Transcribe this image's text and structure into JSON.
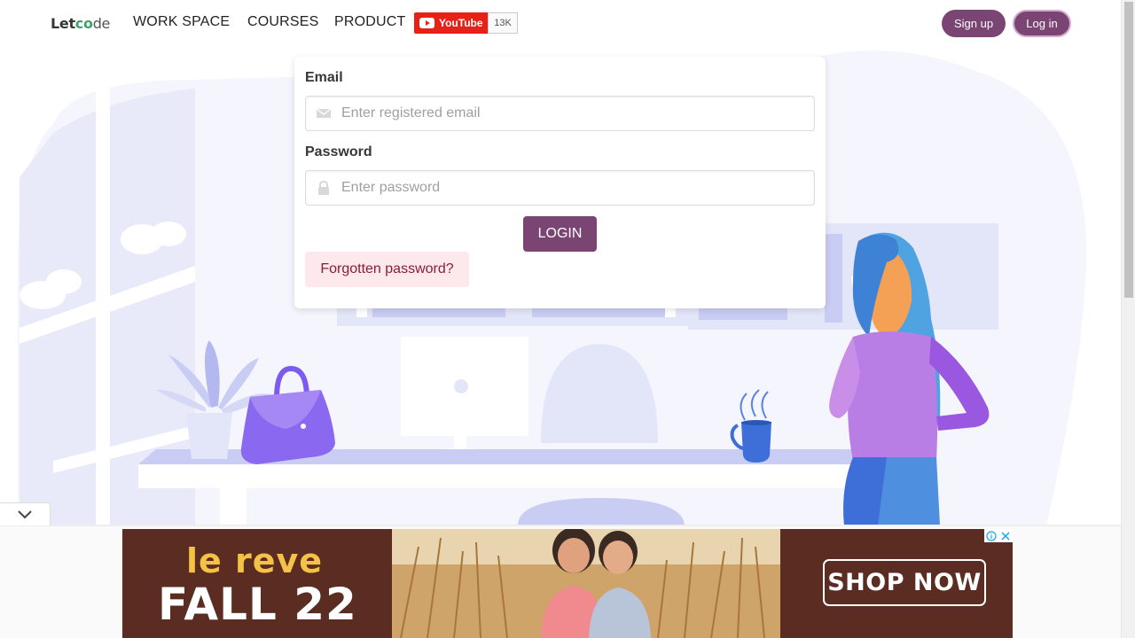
{
  "nav": {
    "logo_let": "Let",
    "logo_co": "co",
    "logo_de": "de",
    "links": [
      "WORK SPACE",
      "COURSES",
      "PRODUCT"
    ],
    "youtube_label": "YouTube",
    "youtube_count": "13K",
    "signup_label": "Sign up",
    "login_label": "Log in"
  },
  "form": {
    "email_label": "Email",
    "email_placeholder": "Enter registered email",
    "email_value": "",
    "password_label": "Password",
    "password_placeholder": "Enter password",
    "password_value": "",
    "submit_label": "LOGIN",
    "forgot_label": "Forgotten password?"
  },
  "ad": {
    "brand": "le reve",
    "season": "FALL 22",
    "cta": "SHOP NOW"
  },
  "colors": {
    "primary": "#7a4473",
    "forgot_bg": "#fde8ec",
    "forgot_text": "#8a1d3a",
    "youtube_red": "#e62117",
    "ad_bg": "#5a2c22",
    "ad_yellow": "#f4c244",
    "illustration_lavender": "#eef0fb"
  },
  "icons": {
    "email_field": "envelope-icon",
    "password_field": "lock-icon",
    "collapse": "chevron-down-icon",
    "youtube": "youtube-play-icon"
  }
}
